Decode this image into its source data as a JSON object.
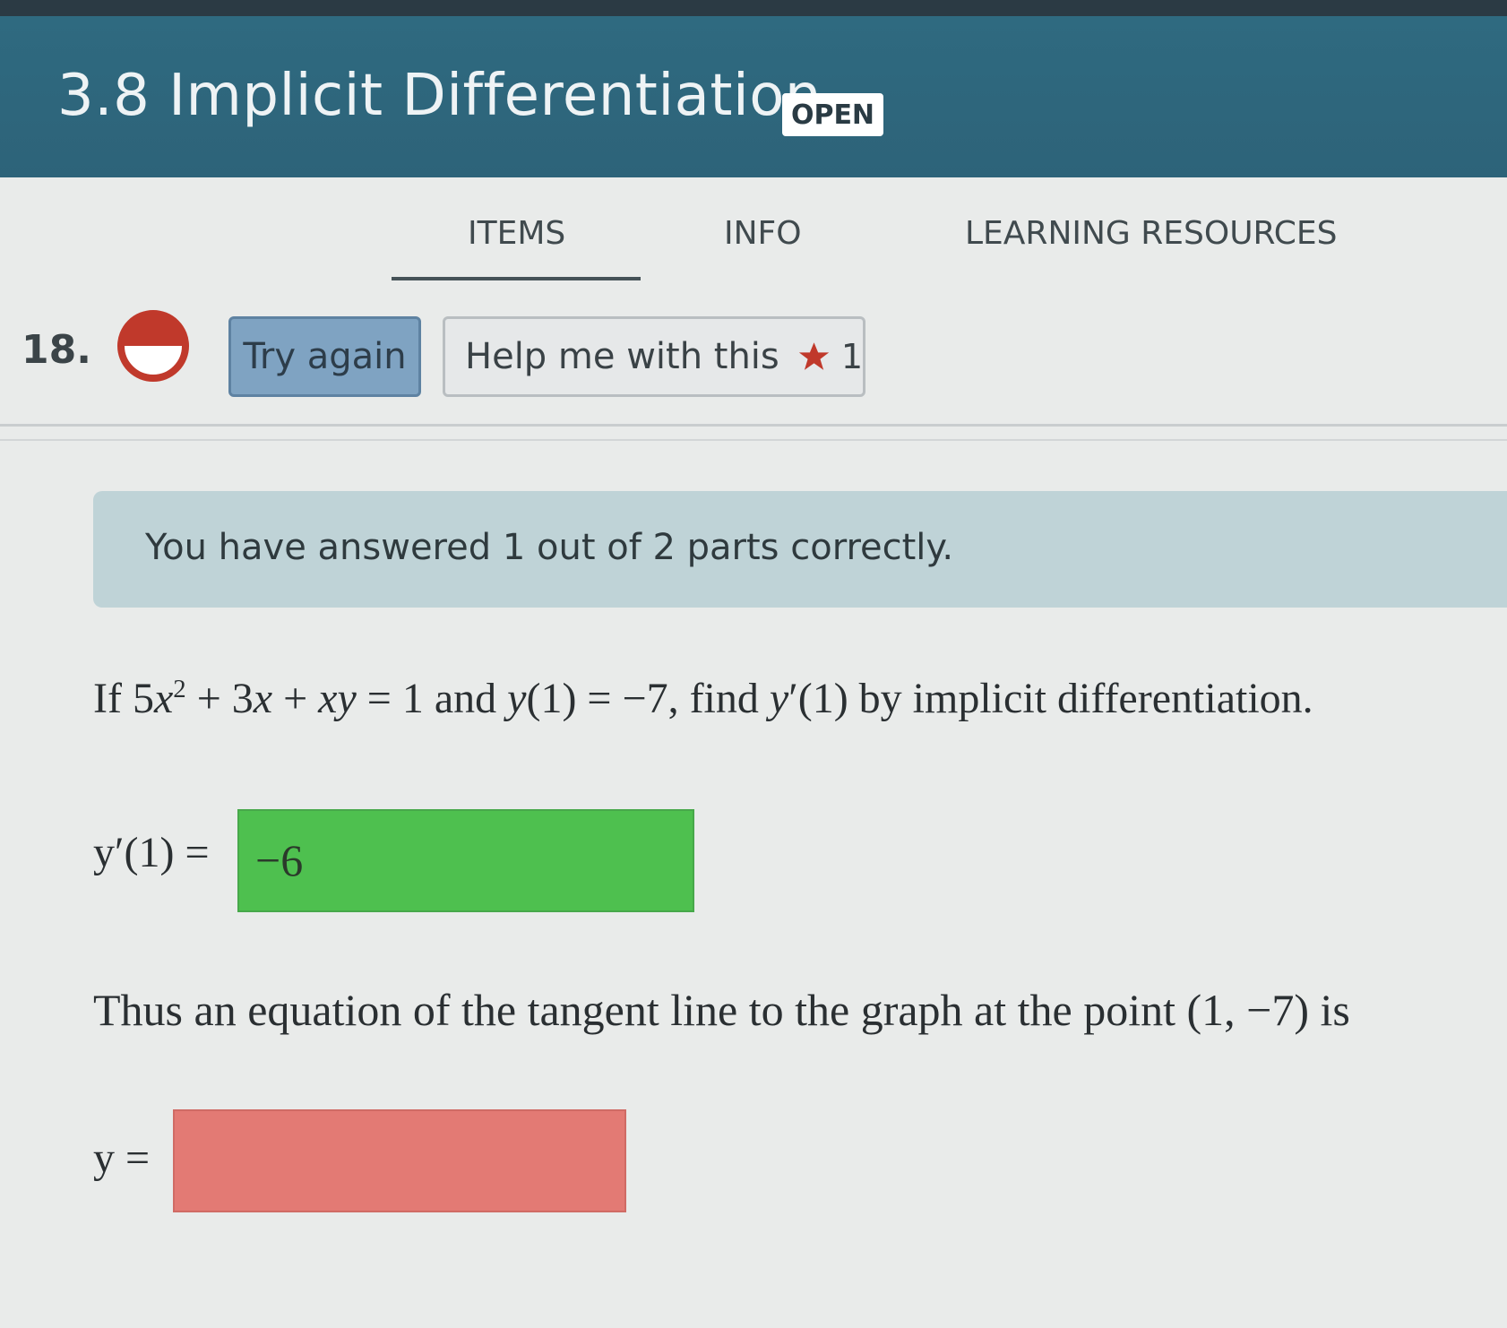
{
  "header": {
    "title": "3.8 Implicit Differentiation",
    "badge": "OPEN"
  },
  "tabs": [
    {
      "label": "ITEMS",
      "active": true
    },
    {
      "label": "INFO",
      "active": false
    },
    {
      "label": "LEARNING RESOURCES",
      "active": false
    }
  ],
  "question": {
    "number": "18.",
    "try_again_label": "Try again",
    "help_label": "Help me with this",
    "help_count": "1",
    "status_icon": "half-filled-circle-icon"
  },
  "feedback": {
    "message": "You have answered 1 out of 2 parts correctly."
  },
  "problem": {
    "part1_label": "y′(1) =",
    "part1_answer": "−6",
    "part1_status": "correct",
    "sentence": "Thus an equation of the tangent line to the graph at the point (1, −7) is",
    "part2_label": "y =",
    "part2_answer": "",
    "part2_status": "incorrect"
  },
  "colors": {
    "header_bg": "#2f6a80",
    "correct": "#4ec04f",
    "incorrect": "#e37a74",
    "banner": "#bfd3d7",
    "try_again": "#7fa3c2",
    "status_red": "#c0392b",
    "star": "#c0392b"
  }
}
